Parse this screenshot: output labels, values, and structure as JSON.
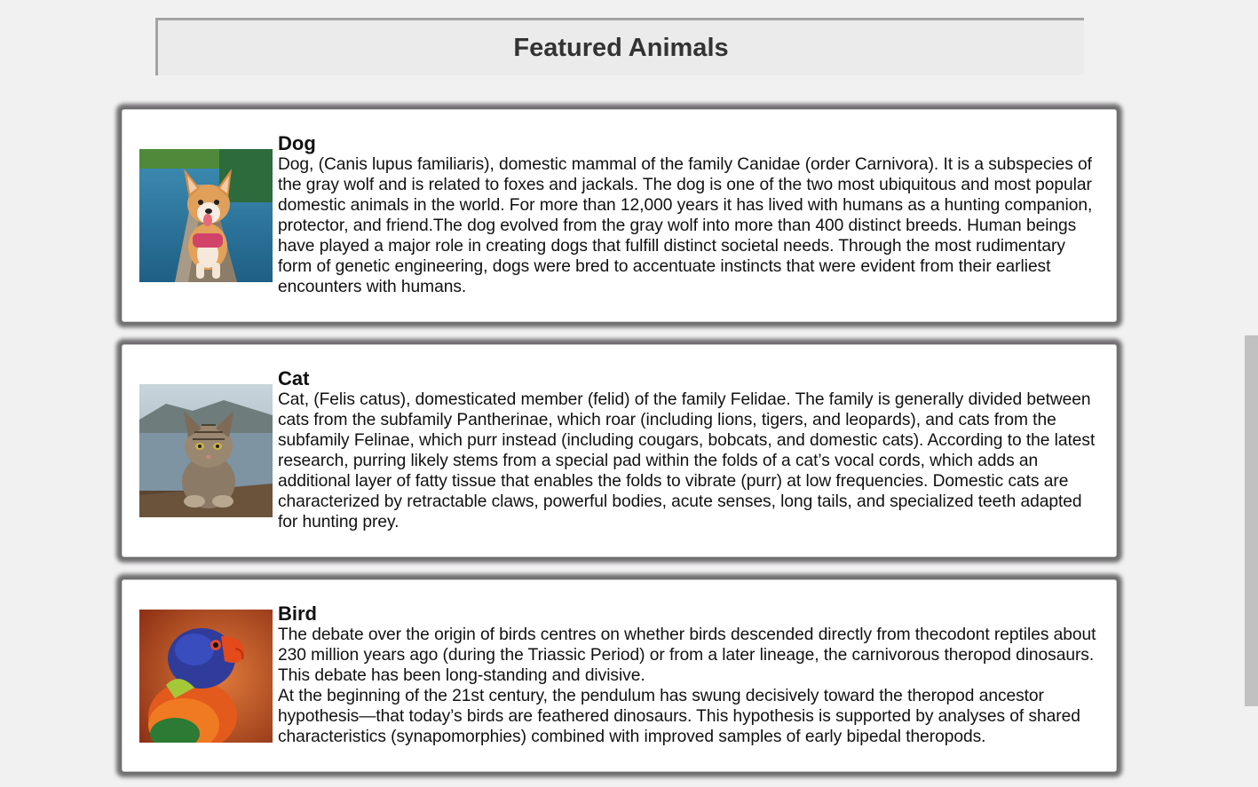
{
  "header": {
    "title": "Featured Animals"
  },
  "animals": [
    {
      "name": "Dog",
      "image_icon": "dog-photo",
      "paragraphs": [
        "Dog, (Canis lupus familiaris), domestic mammal of the family Canidae (order Carnivora). It is a subspecies of the gray wolf and is related to foxes and jackals. The dog is one of the two most ubiquitous and most popular domestic animals in the world. For more than 12,000 years it has lived with humans as a hunting companion, protector, and friend.The dog evolved from the gray wolf into more than 400 distinct breeds. Human beings have played a major role in creating dogs that fulfill distinct societal needs. Through the most rudimentary form of genetic engineering, dogs were bred to accentuate instincts that were evident from their earliest encounters with humans."
      ]
    },
    {
      "name": "Cat",
      "image_icon": "cat-photo",
      "paragraphs": [
        "Cat, (Felis catus), domesticated member (felid) of the family Felidae. The family is generally divided between cats from the subfamily Pantherinae, which roar (including lions, tigers, and leopards), and cats from the subfamily Felinae, which purr instead (including cougars, bobcats, and domestic cats). According to the latest research, purring likely stems from a special pad within the folds of a cat’s vocal cords, which adds an additional layer of fatty tissue that enables the folds to vibrate (purr) at low frequencies. Domestic cats are characterized by retractable claws, powerful bodies, acute senses, long tails, and specialized teeth adapted for hunting prey."
      ]
    },
    {
      "name": "Bird",
      "image_icon": "bird-photo",
      "paragraphs": [
        "The debate over the origin of birds centres on whether birds descended directly from thecodont reptiles about 230 million years ago (during the Triassic Period) or from a later lineage, the carnivorous theropod dinosaurs. This debate has been long-standing and divisive.",
        "At the beginning of the 21st century, the pendulum has swung decisively toward the theropod ancestor hypothesis—that today’s birds are feathered dinosaurs. This hypothesis is supported by analyses of shared characteristics (synapomorphies) combined with improved samples of early bipedal theropods."
      ]
    }
  ],
  "colors": {
    "page_background": "#f1f1f1",
    "card_background": "#ffffff",
    "card_shadow": "#6f6d6f",
    "header_background": "#ebebeb",
    "scroll_thumb": "#c1c1c1"
  }
}
